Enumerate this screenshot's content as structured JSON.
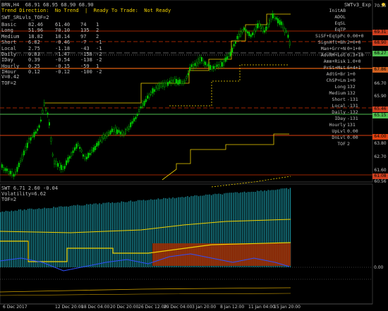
{
  "header": {
    "symbol_line": "BRN,H4  68.91 68.95 68.90 68.90",
    "status_line": "Trend Direction:  No Trend  |  Ready To Trade:  Not Ready",
    "panel_title": "SWT_SRLvls_TOF=2",
    "right_title": "SWTv3_Exp"
  },
  "stats_table": [
    [
      "Basic",
      "82.46",
      "61.40",
      "74",
      "1"
    ],
    [
      "Long",
      "51.96",
      "70.10",
      "135",
      "2"
    ],
    [
      "Medium",
      "18.82",
      "18.14",
      "97",
      "2"
    ],
    [
      "Short",
      "6.82",
      "-0.46",
      "-7",
      "-1"
    ],
    [
      "Local",
      "2.75",
      "-1.18",
      "-43",
      "-1"
    ],
    [
      "Daily",
      "0.03",
      "-1.47",
      "-158",
      "-2"
    ],
    [
      "IDay",
      "0.39",
      "-0.54",
      "-138",
      "-2"
    ],
    [
      "Hourly",
      "0.25",
      "-0.15",
      "-59",
      "1"
    ],
    [
      "IHour",
      "0.12",
      "-0.12",
      "-100",
      "-2"
    ]
  ],
  "left_extra": [
    "V=0.42",
    "TOF=2"
  ],
  "right_labels": [
    {
      "label": "InitAB",
      "value": ""
    },
    {
      "label": "ADOL",
      "value": ""
    },
    {
      "label": "EqSL",
      "value": ""
    },
    {
      "label": "EqTP",
      "value": ""
    },
    {
      "label": "SiSF+EqtpPc",
      "value": "0.00+0"
    },
    {
      "label": "SignHft+Bh",
      "value": "2+0+0"
    },
    {
      "label": "Man+Grr+N",
      "value": "0+1+0"
    },
    {
      "label": "AdvRM+Lot",
      "value": "0.3+10"
    },
    {
      "label": "Amm+Risk",
      "value": "1.0+0"
    },
    {
      "label": "PrSt+Mst",
      "value": "6+4+1"
    },
    {
      "label": "AdtG+Br",
      "value": "1+0"
    },
    {
      "label": "ChSP+Lm",
      "value": "1+0"
    },
    {
      "label": "Long",
      "value": "132"
    },
    {
      "label": "Medium",
      "value": "132"
    },
    {
      "label": "Short",
      "value": "-131"
    },
    {
      "label": "Local",
      "value": "-131"
    },
    {
      "label": "Daily",
      "value": "-132"
    },
    {
      "label": "IDay",
      "value": "-131"
    },
    {
      "label": "Hourly",
      "value": "131"
    },
    {
      "label": "UpLvl",
      "value": "0.00"
    },
    {
      "label": "DnLvl",
      "value": "0.00"
    },
    {
      "label": "TOF",
      "value": "2"
    }
  ],
  "price_tags": [
    {
      "text": "70.35",
      "color": "#b0b0b0"
    },
    {
      "text": "69.31",
      "color": "#d04020"
    },
    {
      "text": "68.90",
      "color": "#d04020"
    },
    {
      "text": "68.27",
      "color": "#50c050"
    },
    {
      "text": "67.86",
      "color": "#d06020"
    },
    {
      "text": "66.70",
      "color": "#b0b0b0"
    },
    {
      "text": "65.90",
      "color": "#b0b0b0"
    },
    {
      "text": "65.46",
      "color": "#d04020"
    },
    {
      "text": "65.15",
      "color": "#50c050"
    },
    {
      "text": "64.00",
      "color": "#e04010"
    },
    {
      "text": "63.80",
      "color": "#b0b0b0"
    },
    {
      "text": "62.70",
      "color": "#b0b0b0"
    },
    {
      "text": "61.60",
      "color": "#b0b0b0"
    },
    {
      "text": "61.08",
      "color": "#d04020"
    },
    {
      "text": "60.56",
      "color": "#b0b0b0"
    }
  ],
  "sub_panel": {
    "title": "SWT 6.71 2.60 -0.04",
    "volatility": "Volatility=6.62",
    "tof": "TOF=2",
    "axis_top": "",
    "axis_zero": "0.00"
  },
  "x_axis": [
    "6 Dec 2017",
    "12 Dec 20:00",
    "18 Dec 04:00",
    "20 Dec 20:00",
    "26 Dec 12:00",
    "29 Dec 04:00",
    "3 Jan 20:00",
    "8 Jan 12:00",
    "11 Jan 04:00",
    "15 Jan 20:00"
  ],
  "colors": {
    "bull": "#00d000",
    "bear": "#00a000",
    "support": "#f0d000",
    "resistance": "#d03000",
    "teal": "#20b0c0"
  }
}
